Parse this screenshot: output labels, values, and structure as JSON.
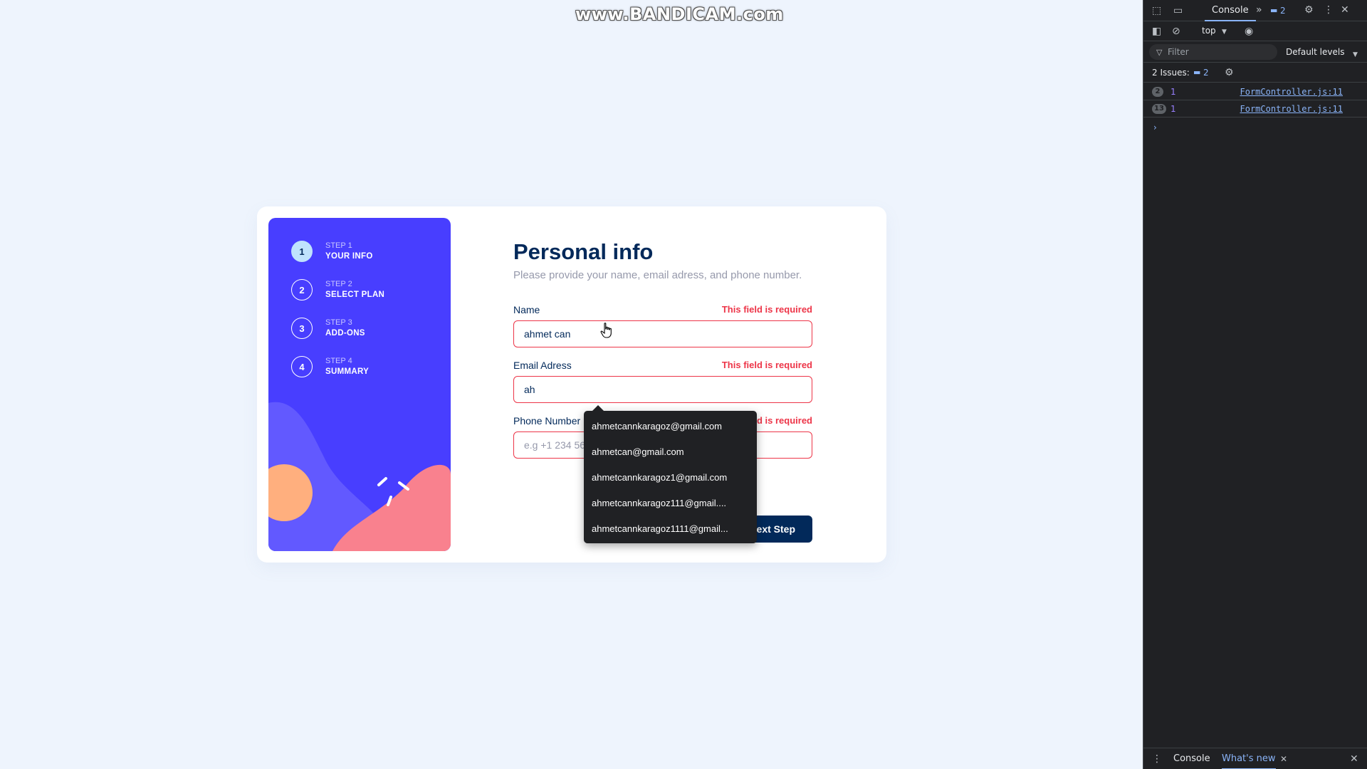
{
  "watermark": "www.BANDICAM.com",
  "steps": [
    {
      "number": "1",
      "label": "STEP 1",
      "title": "YOUR INFO"
    },
    {
      "number": "2",
      "label": "STEP 2",
      "title": "SELECT PLAN"
    },
    {
      "number": "3",
      "label": "STEP 3",
      "title": "ADD-ONS"
    },
    {
      "number": "4",
      "label": "STEP 4",
      "title": "SUMMARY"
    }
  ],
  "form": {
    "title": "Personal info",
    "subtitle": "Please provide your name, email adress, and phone number.",
    "name": {
      "label": "Name",
      "error": "This field is required",
      "value": "ahmet can"
    },
    "email": {
      "label": "Email Adress",
      "error": "This field is required",
      "value": "ah"
    },
    "phone": {
      "label": "Phone Number",
      "error": "This field is required",
      "placeholder": "e.g +1 234 567 890"
    },
    "next_label": "Next Step"
  },
  "autocomplete": [
    "ahmetcannkaragoz@gmail.com",
    "ahmetcan@gmail.com",
    "ahmetcannkaragoz1@gmail.com",
    "ahmetcannkaragoz111@gmail....",
    "ahmetcannkaragoz1111@gmail..."
  ],
  "devtools": {
    "tab_console": "Console",
    "issues_badge": "2",
    "context": "top",
    "filter_placeholder": "Filter",
    "levels": "Default levels",
    "issues_label": "2 Issues:",
    "issues_count": "2",
    "logs": [
      {
        "count": "2",
        "value": "1",
        "source": "FormController.js:11"
      },
      {
        "count": "13",
        "value": "1",
        "source": "FormController.js:11"
      }
    ],
    "prompt": "›",
    "bottom_tabs": [
      "Console",
      "What's new"
    ]
  }
}
